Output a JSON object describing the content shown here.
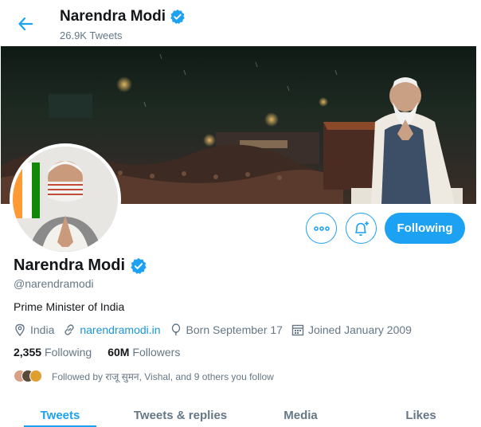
{
  "header": {
    "name": "Narendra Modi",
    "tweet_count": "26.9K Tweets"
  },
  "profile": {
    "name": "Narendra Modi",
    "handle": "@narendramodi",
    "bio": "Prime Minister of India",
    "location": "India",
    "website": "narendramodi.in",
    "birthday": "Born September 17",
    "joined": "Joined January 2009"
  },
  "actions": {
    "follow_label": "Following"
  },
  "stats": {
    "following_count": "2,355",
    "following_label": "Following",
    "followers_count": "60M",
    "followers_label": "Followers"
  },
  "followed_by": "Followed by राजू सुमन, Vishal, and 9 others you follow",
  "tabs": [
    {
      "label": "Tweets",
      "active": true
    },
    {
      "label": "Tweets & replies",
      "active": false
    },
    {
      "label": "Media",
      "active": false
    },
    {
      "label": "Likes",
      "active": false
    }
  ],
  "colors": {
    "accent": "#1da1f2",
    "link": "#1b95e0",
    "muted": "#657786",
    "text": "#14171a"
  },
  "icons": [
    "back-arrow-icon",
    "verified-badge-icon",
    "more-icon",
    "bell-plus-icon",
    "location-pin-icon",
    "link-icon",
    "balloon-icon",
    "calendar-icon"
  ]
}
